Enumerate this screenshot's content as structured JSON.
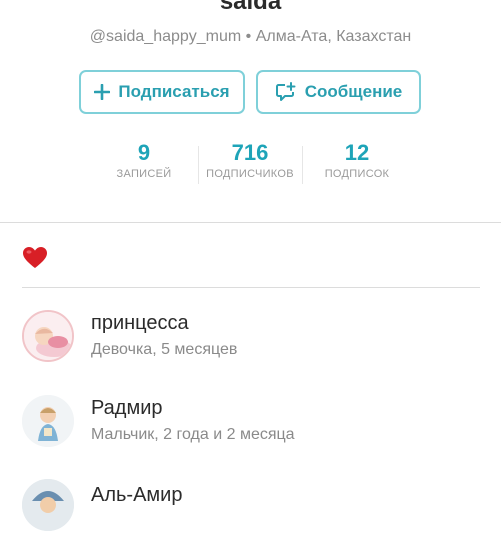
{
  "profile": {
    "username": "saida",
    "handle_line": "@saida_happy_mum • Алма-Ата, Казахстан"
  },
  "actions": {
    "follow_label": "Подписаться",
    "message_label": "Сообщение"
  },
  "stats": [
    {
      "value": "9",
      "label": "ЗАПИСЕЙ"
    },
    {
      "value": "716",
      "label": "ПОДПИСЧИКОВ"
    },
    {
      "value": "12",
      "label": "ПОДПИСОК"
    }
  ],
  "children": [
    {
      "name": "принцесса",
      "desc": "Девочка, 5 месяцев"
    },
    {
      "name": "Радмир",
      "desc": "Мальчик, 2 года и 2 месяца"
    },
    {
      "name": "Аль-Амир",
      "desc": ""
    }
  ],
  "colors": {
    "accent": "#1ea4b8",
    "button_border": "#7fd0d9",
    "heart": "#d81f26"
  }
}
